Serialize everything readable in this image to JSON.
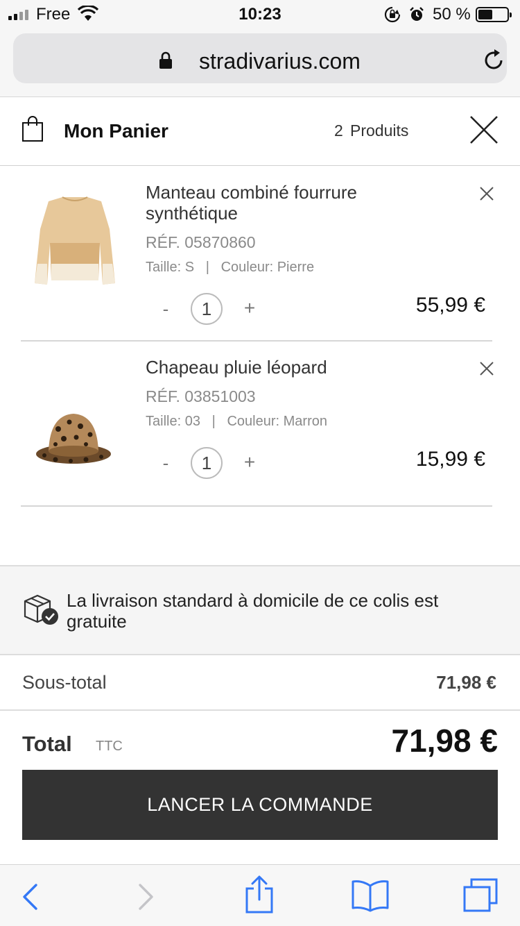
{
  "status_bar": {
    "carrier": "Free",
    "time": "10:23",
    "battery_text": "50 %",
    "battery_level": 0.5
  },
  "browser": {
    "url": "stradivarius.com"
  },
  "cart": {
    "title": "Mon Panier",
    "count": "2",
    "count_label": "Produits",
    "items": [
      {
        "name": "Manteau combiné fourrure synthétique",
        "ref": "RÉF. 05870860",
        "attributes": "Taille: S   |   Couleur: Pierre",
        "quantity": "1",
        "minus": "-",
        "plus": "+",
        "price": "55,99 €",
        "image": "coat-image"
      },
      {
        "name": "Chapeau pluie léopard",
        "ref": "RÉF. 03851003",
        "attributes": "Taille: 03   |   Couleur: Marron",
        "quantity": "1",
        "minus": "-",
        "plus": "+",
        "price": "15,99 €",
        "image": "leopard-hat-image"
      }
    ]
  },
  "delivery": {
    "text": "La livraison standard à domicile de ce colis est gratuite",
    "icon": "package-check-icon"
  },
  "totals": {
    "subtotal_label": "Sous-total",
    "subtotal_value": "71,98 €",
    "total_label": "Total",
    "tax_label": "TTC",
    "total_value": "71,98 €"
  },
  "checkout": {
    "label": "LANCER LA COMMANDE"
  },
  "toolbar": {
    "icons": [
      "back-icon",
      "forward-icon",
      "share-icon",
      "bookmarks-icon",
      "tabs-icon"
    ]
  },
  "colors": {
    "accent_ios": "#3478f6",
    "checkout_bg": "#333333"
  }
}
